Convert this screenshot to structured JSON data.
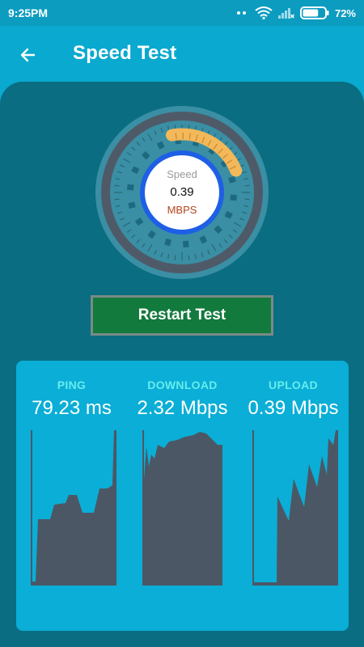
{
  "status_bar": {
    "time": "9:25PM",
    "battery": "72%",
    "battery_level": 0.72,
    "icons": [
      "wifi-icon",
      "cell-signal-icon",
      "battery-icon"
    ]
  },
  "app_bar": {
    "title": "Speed Test",
    "back_icon": "arrow-left-icon"
  },
  "gauge": {
    "label": "Speed",
    "value": "0.39",
    "unit": "MBPS"
  },
  "restart_button": {
    "label": "Restart Test"
  },
  "stats": [
    {
      "title": "PING",
      "value": "79.23 ms"
    },
    {
      "title": "DOWNLOAD",
      "value": "2.32 Mbps"
    },
    {
      "title": "UPLOAD",
      "value": "0.39 Mbps"
    }
  ],
  "colors": {
    "primary": "#0aa9cf",
    "card": "#0a6d82",
    "button": "#137a3d",
    "graph_fill": "#4c5766",
    "stat_title": "#66ecee",
    "gauge_accent": "#f2b85a",
    "gauge_ring": "#1e5fe6"
  }
}
